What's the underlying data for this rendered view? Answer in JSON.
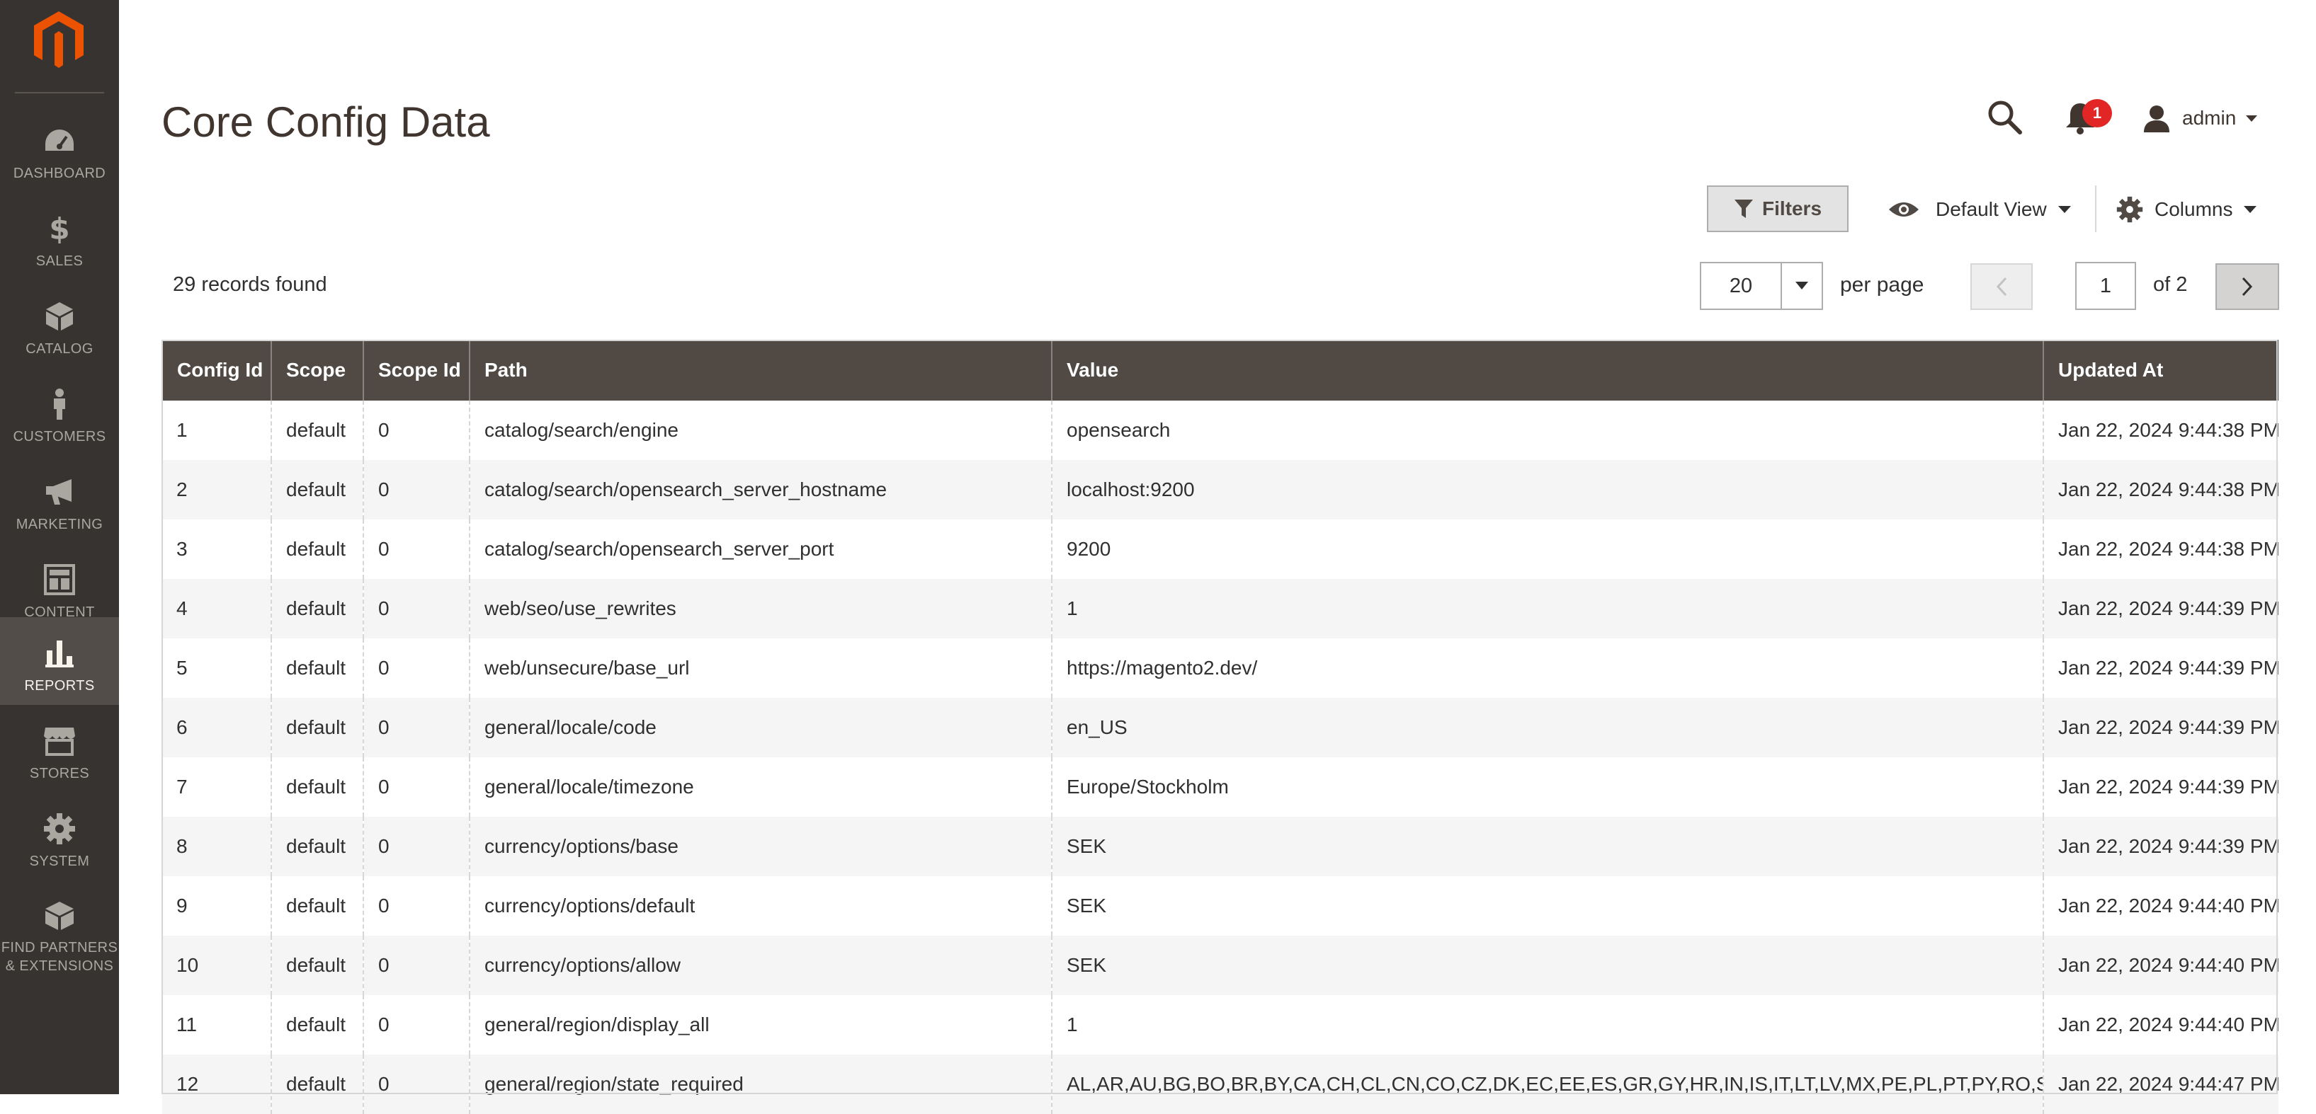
{
  "sidebar": {
    "items": [
      {
        "label": "DASHBOARD",
        "icon": "dashboard-icon"
      },
      {
        "label": "SALES",
        "icon": "dollar-icon"
      },
      {
        "label": "CATALOG",
        "icon": "box-icon"
      },
      {
        "label": "CUSTOMERS",
        "icon": "person-icon"
      },
      {
        "label": "MARKETING",
        "icon": "megaphone-icon"
      },
      {
        "label": "CONTENT",
        "icon": "layout-icon"
      },
      {
        "label": "REPORTS",
        "icon": "bar-chart-icon"
      },
      {
        "label": "STORES",
        "icon": "storefront-icon"
      },
      {
        "label": "SYSTEM",
        "icon": "gear-icon"
      },
      {
        "label_line1": "FIND PARTNERS",
        "label_line2": "& EXTENSIONS",
        "icon": "cubes-icon"
      }
    ],
    "active": "REPORTS"
  },
  "header": {
    "title": "Core Config Data",
    "notification_count": "1",
    "user": "admin"
  },
  "toolbar": {
    "filters_label": "Filters",
    "view_label": "Default View",
    "columns_label": "Columns",
    "records_found": "29 records found",
    "per_page_value": "20",
    "per_page_label": "per page",
    "current_page": "1",
    "page_total": "of 2"
  },
  "grid": {
    "columns": [
      "Config Id",
      "Scope",
      "Scope Id",
      "Path",
      "Value",
      "Updated At"
    ],
    "rows": [
      [
        "1",
        "default",
        "0",
        "catalog/search/engine",
        "opensearch",
        "Jan 22, 2024 9:44:38 PM"
      ],
      [
        "2",
        "default",
        "0",
        "catalog/search/opensearch_server_hostname",
        "localhost:9200",
        "Jan 22, 2024 9:44:38 PM"
      ],
      [
        "3",
        "default",
        "0",
        "catalog/search/opensearch_server_port",
        "9200",
        "Jan 22, 2024 9:44:38 PM"
      ],
      [
        "4",
        "default",
        "0",
        "web/seo/use_rewrites",
        "1",
        "Jan 22, 2024 9:44:39 PM"
      ],
      [
        "5",
        "default",
        "0",
        "web/unsecure/base_url",
        "https://magento2.dev/",
        "Jan 22, 2024 9:44:39 PM"
      ],
      [
        "6",
        "default",
        "0",
        "general/locale/code",
        "en_US",
        "Jan 22, 2024 9:44:39 PM"
      ],
      [
        "7",
        "default",
        "0",
        "general/locale/timezone",
        "Europe/Stockholm",
        "Jan 22, 2024 9:44:39 PM"
      ],
      [
        "8",
        "default",
        "0",
        "currency/options/base",
        "SEK",
        "Jan 22, 2024 9:44:39 PM"
      ],
      [
        "9",
        "default",
        "0",
        "currency/options/default",
        "SEK",
        "Jan 22, 2024 9:44:40 PM"
      ],
      [
        "10",
        "default",
        "0",
        "currency/options/allow",
        "SEK",
        "Jan 22, 2024 9:44:40 PM"
      ],
      [
        "11",
        "default",
        "0",
        "general/region/display_all",
        "1",
        "Jan 22, 2024 9:44:40 PM"
      ],
      [
        "12",
        "default",
        "0",
        "general/region/state_required",
        "AL,AR,AU,BG,BO,BR,BY,CA,CH,CL,CN,CO,CZ,DK,EC,EE,ES,GR,GY,HR,IN,IS,IT,LT,LV,MX,PE,PL,PT,PY,RO,SE,SR,US,UY,VE",
        "Jan 22, 2024 9:44:47 PM"
      ]
    ]
  },
  "colors": {
    "sidebar_bg": "#373330",
    "sidebar_active_bg": "#524d49",
    "logo_orange": "#eb5202",
    "grid_header_bg": "#514943",
    "badge_red": "#e22626"
  }
}
